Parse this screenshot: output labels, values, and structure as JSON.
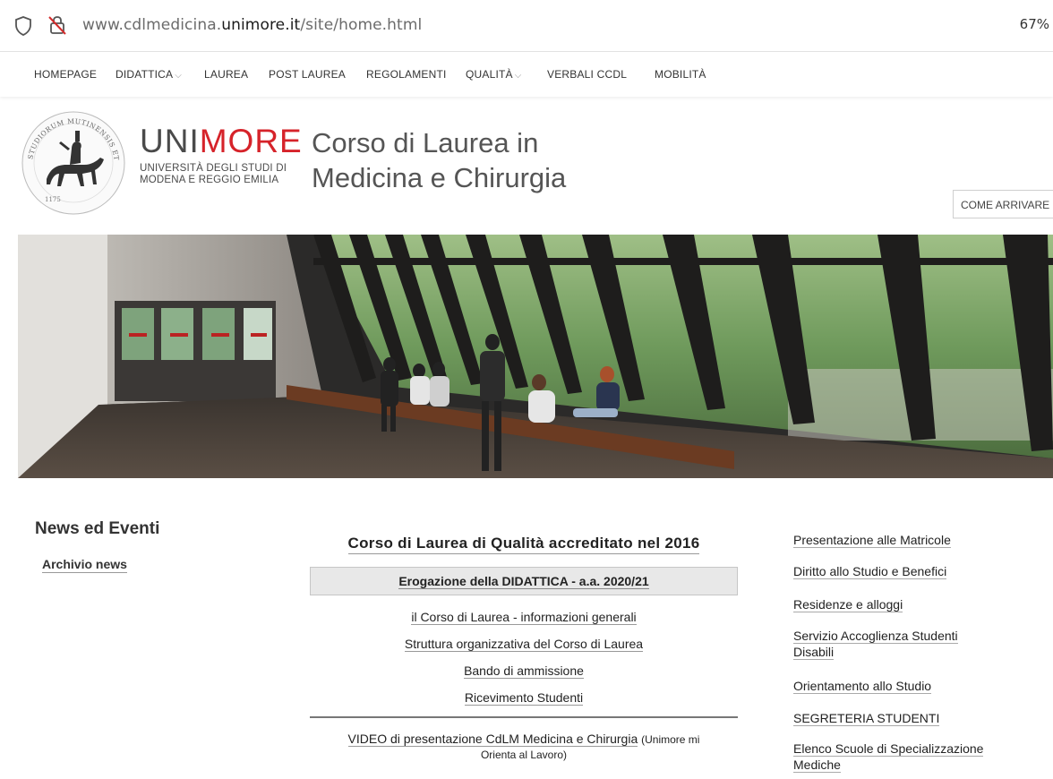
{
  "browser": {
    "url_prefix": "www.cdlmedicina.",
    "url_host": "unimore.it",
    "url_path": "/site/home.html",
    "zoom": "67%",
    "icons": [
      "shield-icon",
      "insecure-lock-icon"
    ]
  },
  "nav": {
    "items": [
      {
        "label": "HOMEPAGE",
        "has_menu": false
      },
      {
        "label": "DIDATTICA",
        "has_menu": true
      },
      {
        "label": "LAUREA",
        "has_menu": false
      },
      {
        "label": "POST LAUREA",
        "has_menu": false
      },
      {
        "label": "REGOLAMENTI",
        "has_menu": false
      },
      {
        "label": "QUALITÀ",
        "has_menu": true
      },
      {
        "label": "VERBALI CCDL",
        "has_menu": false
      },
      {
        "label": "MOBILITÀ",
        "has_menu": false
      }
    ]
  },
  "header": {
    "brand_part1": "UNI",
    "brand_part2": "MORE",
    "brand_sub_line1": "UNIVERSITÀ DEGLI STUDI DI",
    "brand_sub_line2": "MODENA E REGGIO EMILIA",
    "seal_text": "STUDIORUM MUTINENSIS ET REGIENSIS",
    "seal_year": "1175",
    "course_line1": "Corso di Laurea in",
    "course_line2": "Medicina e Chirurgia",
    "come_arrivare": "COME ARRIVARE",
    "brand_color": "#d6232a"
  },
  "left": {
    "title": "News ed Eventi",
    "link": "Archivio news"
  },
  "center": {
    "qualita": "Corso di Laurea di Qualità accreditato nel 2016",
    "didattica": "Erogazione della DIDATTICA - a.a. 2020/21",
    "links": [
      "il Corso di Laurea - informazioni generali",
      "Struttura organizzativa del Corso di Laurea",
      "Bando di ammissione",
      "Ricevimento Studenti"
    ],
    "video_link": "VIDEO di presentazione CdLM Medicina e Chirurgia",
    "video_note_1": "(Unimore mi",
    "video_note_2": "Orienta al Lavoro)"
  },
  "right": {
    "links": [
      {
        "line1": "Presentazione alle Matricole",
        "line2": ""
      },
      {
        "line1": "Diritto allo Studio e Benefici",
        "line2": ""
      },
      {
        "line1": "Residenze e alloggi",
        "line2": ""
      },
      {
        "line1": "Servizio Accoglienza Studenti",
        "line2": "Disabili"
      },
      {
        "line1": "Orientamento allo Studio",
        "line2": ""
      },
      {
        "line1": "SEGRETERIA STUDENTI",
        "line2": ""
      },
      {
        "line1": "Elenco Scuole di Specializzazione",
        "line2": "Mediche"
      }
    ]
  }
}
